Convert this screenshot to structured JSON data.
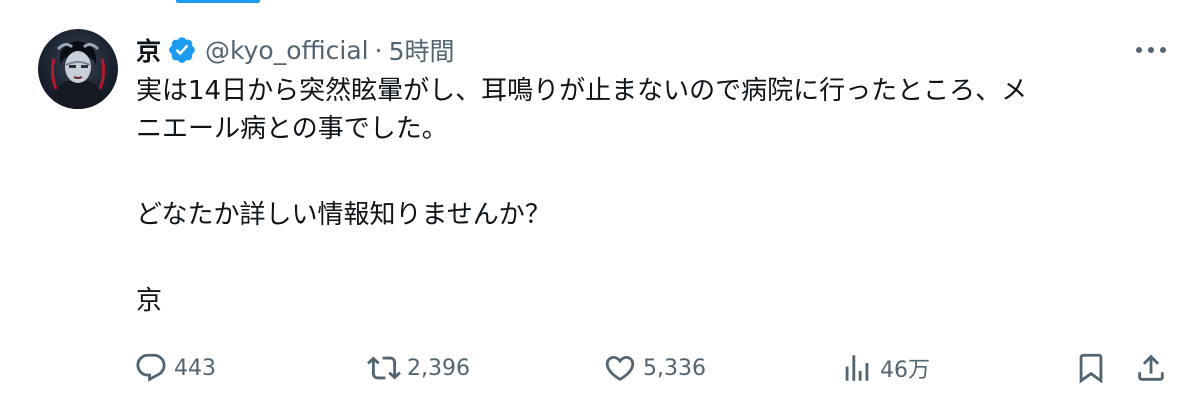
{
  "tweet": {
    "author": {
      "display_name": "京",
      "handle": "@kyo_official",
      "verified": true,
      "verified_color": "#1d9bf0",
      "avatar_icon": "user-avatar"
    },
    "separator": "·",
    "timestamp": "5時間",
    "text": {
      "line1": "実は14日から突然眩暈がし、耳鳴りが止まないので病院に行ったところ、メ",
      "line2": "ニエール病との事でした。",
      "line3": "どなたか詳しい情報知りませんか？",
      "line4": "京"
    },
    "actions": {
      "reply": {
        "icon": "reply-icon",
        "count": "443"
      },
      "retweet": {
        "icon": "retweet-icon",
        "count": "2,396"
      },
      "like": {
        "icon": "heart-icon",
        "count": "5,336"
      },
      "views": {
        "icon": "views-icon",
        "count": "46万"
      },
      "bookmark": {
        "icon": "bookmark-icon"
      },
      "share": {
        "icon": "share-icon"
      }
    },
    "more_icon": "more-horizontal-icon"
  },
  "colors": {
    "text_primary": "#0f1419",
    "text_secondary": "#536471",
    "accent": "#1d9bf0"
  }
}
